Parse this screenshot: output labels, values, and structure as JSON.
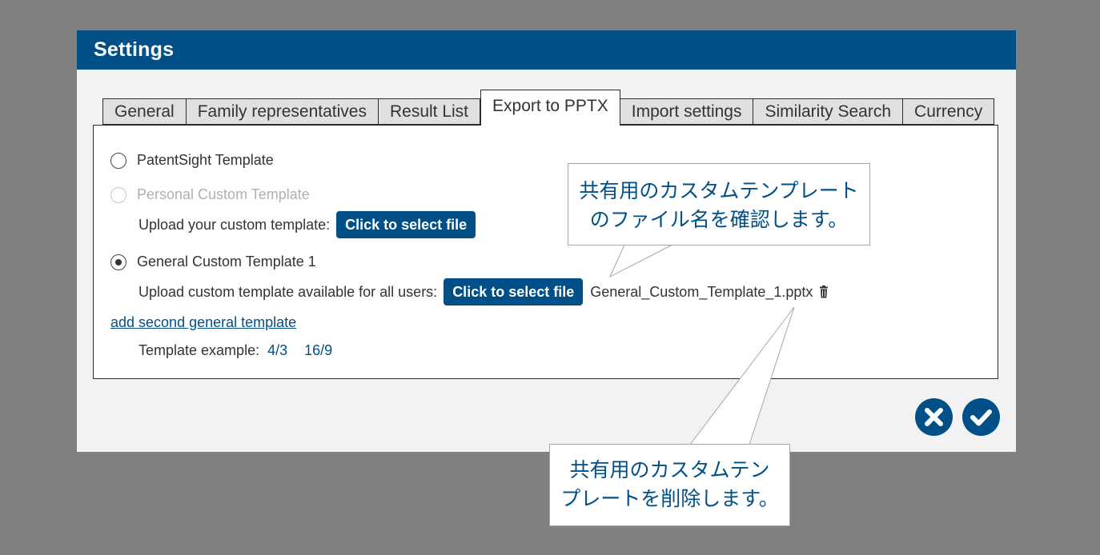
{
  "dialog": {
    "title": "Settings"
  },
  "tabs": [
    {
      "label": "General"
    },
    {
      "label": "Family representatives"
    },
    {
      "label": "Result List"
    },
    {
      "label": "Export to PPTX",
      "active": true
    },
    {
      "label": "Import settings"
    },
    {
      "label": "Similarity Search"
    },
    {
      "label": "Currency"
    }
  ],
  "export": {
    "option_patentsight": "PatentSight Template",
    "option_personal": "Personal Custom Template",
    "upload_personal_label": "Upload your custom template:",
    "select_file_label": "Click to select file",
    "option_general": "General Custom Template 1",
    "upload_general_label": "Upload custom template available for all users:",
    "select_file_label_2": "Click to select file",
    "general_filename": "General_Custom_Template_1.pptx",
    "add_second_link": "add second general template",
    "example_label": "Template example:",
    "example_43": "4/3",
    "example_169": "16/9",
    "selected_option": "General Custom Template 1"
  },
  "actions": {
    "cancel_icon": "close-icon",
    "confirm_icon": "check-icon"
  },
  "callouts": {
    "filename_line1": "共有用のカスタムテンプレート",
    "filename_line2": "のファイル名を確認します。",
    "delete_line1": "共有用のカスタムテン",
    "delete_line2": "プレートを削除します。"
  },
  "colors": {
    "brand": "#005087",
    "background": "#808080",
    "dialog": "#f2f2f2"
  }
}
